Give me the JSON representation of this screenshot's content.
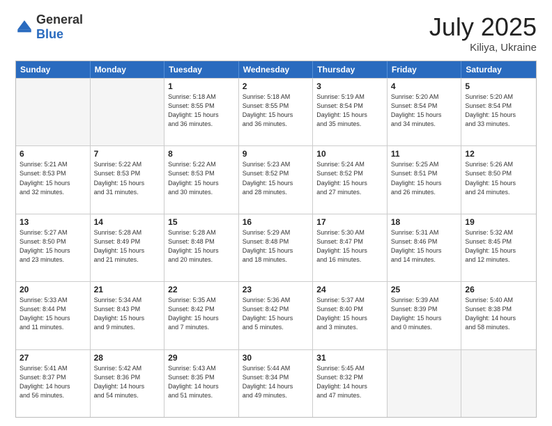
{
  "header": {
    "logo": {
      "general": "General",
      "blue": "Blue"
    },
    "month_year": "July 2025",
    "location": "Kiliya, Ukraine"
  },
  "days_of_week": [
    "Sunday",
    "Monday",
    "Tuesday",
    "Wednesday",
    "Thursday",
    "Friday",
    "Saturday"
  ],
  "rows": [
    [
      {
        "day": "",
        "info": ""
      },
      {
        "day": "",
        "info": ""
      },
      {
        "day": "1",
        "info": "Sunrise: 5:18 AM\nSunset: 8:55 PM\nDaylight: 15 hours\nand 36 minutes."
      },
      {
        "day": "2",
        "info": "Sunrise: 5:18 AM\nSunset: 8:55 PM\nDaylight: 15 hours\nand 36 minutes."
      },
      {
        "day": "3",
        "info": "Sunrise: 5:19 AM\nSunset: 8:54 PM\nDaylight: 15 hours\nand 35 minutes."
      },
      {
        "day": "4",
        "info": "Sunrise: 5:20 AM\nSunset: 8:54 PM\nDaylight: 15 hours\nand 34 minutes."
      },
      {
        "day": "5",
        "info": "Sunrise: 5:20 AM\nSunset: 8:54 PM\nDaylight: 15 hours\nand 33 minutes."
      }
    ],
    [
      {
        "day": "6",
        "info": "Sunrise: 5:21 AM\nSunset: 8:53 PM\nDaylight: 15 hours\nand 32 minutes."
      },
      {
        "day": "7",
        "info": "Sunrise: 5:22 AM\nSunset: 8:53 PM\nDaylight: 15 hours\nand 31 minutes."
      },
      {
        "day": "8",
        "info": "Sunrise: 5:22 AM\nSunset: 8:53 PM\nDaylight: 15 hours\nand 30 minutes."
      },
      {
        "day": "9",
        "info": "Sunrise: 5:23 AM\nSunset: 8:52 PM\nDaylight: 15 hours\nand 28 minutes."
      },
      {
        "day": "10",
        "info": "Sunrise: 5:24 AM\nSunset: 8:52 PM\nDaylight: 15 hours\nand 27 minutes."
      },
      {
        "day": "11",
        "info": "Sunrise: 5:25 AM\nSunset: 8:51 PM\nDaylight: 15 hours\nand 26 minutes."
      },
      {
        "day": "12",
        "info": "Sunrise: 5:26 AM\nSunset: 8:50 PM\nDaylight: 15 hours\nand 24 minutes."
      }
    ],
    [
      {
        "day": "13",
        "info": "Sunrise: 5:27 AM\nSunset: 8:50 PM\nDaylight: 15 hours\nand 23 minutes."
      },
      {
        "day": "14",
        "info": "Sunrise: 5:28 AM\nSunset: 8:49 PM\nDaylight: 15 hours\nand 21 minutes."
      },
      {
        "day": "15",
        "info": "Sunrise: 5:28 AM\nSunset: 8:48 PM\nDaylight: 15 hours\nand 20 minutes."
      },
      {
        "day": "16",
        "info": "Sunrise: 5:29 AM\nSunset: 8:48 PM\nDaylight: 15 hours\nand 18 minutes."
      },
      {
        "day": "17",
        "info": "Sunrise: 5:30 AM\nSunset: 8:47 PM\nDaylight: 15 hours\nand 16 minutes."
      },
      {
        "day": "18",
        "info": "Sunrise: 5:31 AM\nSunset: 8:46 PM\nDaylight: 15 hours\nand 14 minutes."
      },
      {
        "day": "19",
        "info": "Sunrise: 5:32 AM\nSunset: 8:45 PM\nDaylight: 15 hours\nand 12 minutes."
      }
    ],
    [
      {
        "day": "20",
        "info": "Sunrise: 5:33 AM\nSunset: 8:44 PM\nDaylight: 15 hours\nand 11 minutes."
      },
      {
        "day": "21",
        "info": "Sunrise: 5:34 AM\nSunset: 8:43 PM\nDaylight: 15 hours\nand 9 minutes."
      },
      {
        "day": "22",
        "info": "Sunrise: 5:35 AM\nSunset: 8:42 PM\nDaylight: 15 hours\nand 7 minutes."
      },
      {
        "day": "23",
        "info": "Sunrise: 5:36 AM\nSunset: 8:42 PM\nDaylight: 15 hours\nand 5 minutes."
      },
      {
        "day": "24",
        "info": "Sunrise: 5:37 AM\nSunset: 8:40 PM\nDaylight: 15 hours\nand 3 minutes."
      },
      {
        "day": "25",
        "info": "Sunrise: 5:39 AM\nSunset: 8:39 PM\nDaylight: 15 hours\nand 0 minutes."
      },
      {
        "day": "26",
        "info": "Sunrise: 5:40 AM\nSunset: 8:38 PM\nDaylight: 14 hours\nand 58 minutes."
      }
    ],
    [
      {
        "day": "27",
        "info": "Sunrise: 5:41 AM\nSunset: 8:37 PM\nDaylight: 14 hours\nand 56 minutes."
      },
      {
        "day": "28",
        "info": "Sunrise: 5:42 AM\nSunset: 8:36 PM\nDaylight: 14 hours\nand 54 minutes."
      },
      {
        "day": "29",
        "info": "Sunrise: 5:43 AM\nSunset: 8:35 PM\nDaylight: 14 hours\nand 51 minutes."
      },
      {
        "day": "30",
        "info": "Sunrise: 5:44 AM\nSunset: 8:34 PM\nDaylight: 14 hours\nand 49 minutes."
      },
      {
        "day": "31",
        "info": "Sunrise: 5:45 AM\nSunset: 8:32 PM\nDaylight: 14 hours\nand 47 minutes."
      },
      {
        "day": "",
        "info": ""
      },
      {
        "day": "",
        "info": ""
      }
    ]
  ]
}
